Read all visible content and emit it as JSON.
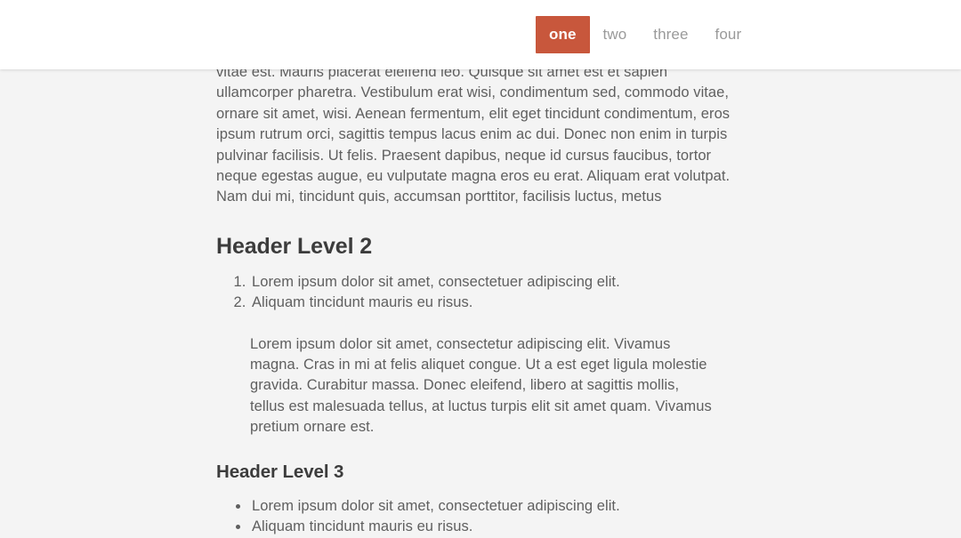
{
  "topbar": {
    "nav_items": [
      {
        "label": "one",
        "active": true
      },
      {
        "label": "two",
        "active": false
      },
      {
        "label": "three",
        "active": false
      },
      {
        "label": "four",
        "active": false
      }
    ],
    "active_color": "#c8573c",
    "active_text_color": "#ffffff",
    "inactive_text_color": "#9a9a9a",
    "background": "#ffffff"
  },
  "page": {
    "background": "#f4f4f4",
    "text_color": "#5f5f5f",
    "heading_color": "#3c3c3c"
  },
  "main": {
    "intro_paragraph": "vitae est. Mauris placerat eleifend leo. Quisque sit amet est et sapien ullamcorper pharetra. Vestibulum erat wisi, condimentum sed, commodo vitae, ornare sit amet, wisi. Aenean fermentum, elit eget tincidunt condimentum, eros ipsum rutrum orci, sagittis tempus lacus enim ac dui. Donec non enim in turpis pulvinar facilisis. Ut felis. Praesent dapibus, neque id cursus faucibus, tortor neque egestas augue, eu vulputate magna eros eu erat. Aliquam erat volutpat. Nam dui mi, tincidunt quis, accumsan porttitor, facilisis luctus, metus",
    "header_level_2": "Header Level 2",
    "ordered_list": [
      "Lorem ipsum dolor sit amet, consectetuer adipiscing elit.",
      "Aliquam tincidunt mauris eu risus."
    ],
    "indented_paragraph": "Lorem ipsum dolor sit amet, consectetur adipiscing elit. Vivamus magna. Cras in mi at felis aliquet congue. Ut a est eget ligula molestie gravida. Curabitur massa. Donec eleifend, libero at sagittis mollis, tellus est malesuada tellus, at luctus turpis elit sit amet quam. Vivamus pretium ornare est.",
    "header_level_3": "Header Level 3",
    "unordered_list": [
      "Lorem ipsum dolor sit amet, consectetuer adipiscing elit.",
      "Aliquam tincidunt mauris eu risus."
    ]
  }
}
